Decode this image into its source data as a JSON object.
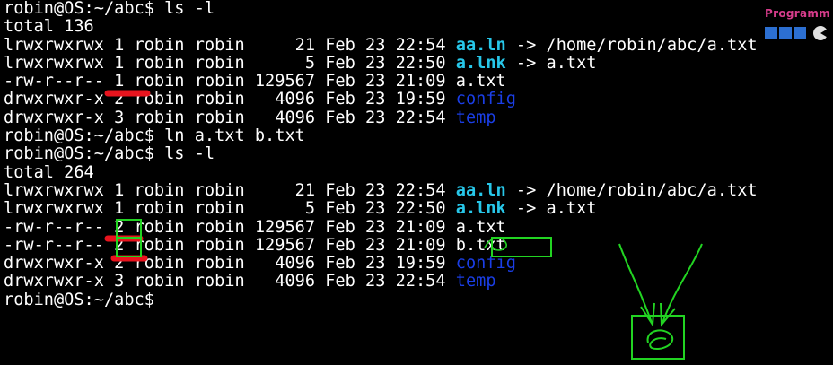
{
  "logo": {
    "text": "Programm"
  },
  "lines": [
    {
      "parts": [
        {
          "t": "robin@OS:~/abc$ ls -l",
          "c": ""
        }
      ]
    },
    {
      "parts": [
        {
          "t": "total 136",
          "c": ""
        }
      ]
    },
    {
      "parts": [
        {
          "t": "lrwxrwxrwx 1 robin robin     21 Feb 23 22:54 ",
          "c": ""
        },
        {
          "t": "aa.ln",
          "c": "cyan"
        },
        {
          "t": " -> /home/robin/abc/a.txt",
          "c": ""
        }
      ]
    },
    {
      "parts": [
        {
          "t": "lrwxrwxrwx 1 robin robin      5 Feb 23 22:50 ",
          "c": ""
        },
        {
          "t": "a.lnk",
          "c": "cyan"
        },
        {
          "t": " -> a.txt",
          "c": ""
        }
      ]
    },
    {
      "parts": [
        {
          "t": "-rw-r--r-- 1 robin robin 129567 Feb 23 21:09 a.txt",
          "c": ""
        }
      ]
    },
    {
      "parts": [
        {
          "t": "drwxrwxr-x 2 robin robin   4096 Feb 23 19:59 ",
          "c": ""
        },
        {
          "t": "config",
          "c": "blue"
        }
      ]
    },
    {
      "parts": [
        {
          "t": "drwxrwxr-x 3 robin robin   4096 Feb 23 22:54 ",
          "c": ""
        },
        {
          "t": "temp",
          "c": "blue"
        }
      ]
    },
    {
      "parts": [
        {
          "t": "robin@OS:~/abc$ ln a.txt b.txt",
          "c": ""
        }
      ]
    },
    {
      "parts": [
        {
          "t": "robin@OS:~/abc$ ls -l",
          "c": ""
        }
      ]
    },
    {
      "parts": [
        {
          "t": "total 264",
          "c": ""
        }
      ]
    },
    {
      "parts": [
        {
          "t": "lrwxrwxrwx 1 robin robin     21 Feb 23 22:54 ",
          "c": ""
        },
        {
          "t": "aa.ln",
          "c": "cyan"
        },
        {
          "t": " -> /home/robin/abc/a.txt",
          "c": ""
        }
      ]
    },
    {
      "parts": [
        {
          "t": "lrwxrwxrwx 1 robin robin      5 Feb 23 22:50 ",
          "c": ""
        },
        {
          "t": "a.lnk",
          "c": "cyan"
        },
        {
          "t": " -> a.txt",
          "c": ""
        }
      ]
    },
    {
      "parts": [
        {
          "t": "-rw-r--r-- 2 robin robin 129567 Feb 23 21:09 a.txt",
          "c": ""
        }
      ]
    },
    {
      "parts": [
        {
          "t": "-rw-r--r-- 2 robin robin 129567 Feb 23 21:09 b.txt",
          "c": ""
        }
      ]
    },
    {
      "parts": [
        {
          "t": "drwxrwxr-x 2 robin robin   4096 Feb 23 19:59 ",
          "c": ""
        },
        {
          "t": "config",
          "c": "blue"
        }
      ]
    },
    {
      "parts": [
        {
          "t": "drwxrwxr-x 3 robin robin   4096 Feb 23 22:54 ",
          "c": ""
        },
        {
          "t": "temp",
          "c": "blue"
        }
      ]
    },
    {
      "parts": [
        {
          "t": "robin@OS:~/abc$",
          "c": ""
        }
      ]
    }
  ],
  "colors": {
    "background": "#000000",
    "text": "#ffffff",
    "directory": "#1a3ee6",
    "symlink": "#27c7e9",
    "annotation_red": "#e8141e",
    "annotation_green": "#22d422",
    "logo": "#d63c8b"
  }
}
